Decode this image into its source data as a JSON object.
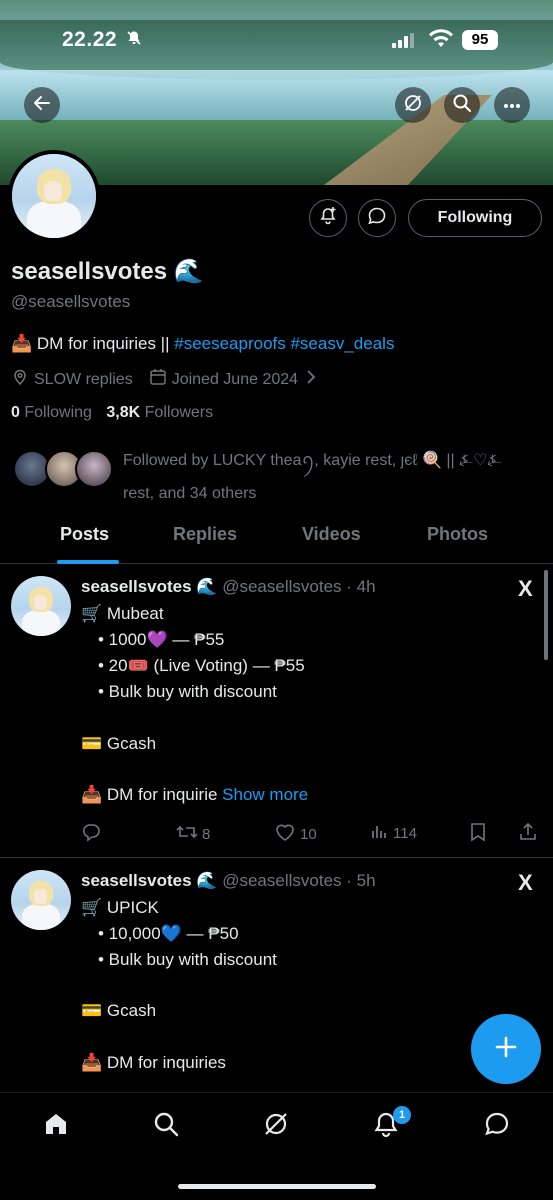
{
  "status_bar": {
    "time": "22.22",
    "battery": "95"
  },
  "profile": {
    "display_name": "seasellsvotes",
    "name_emoji": "🌊",
    "handle": "@seasellsvotes",
    "bio_emoji": "📥",
    "bio_text": "DM for inquiries ||",
    "bio_hashtags": "#seeseaproofs #seasv_deals",
    "location": "SLOW replies",
    "joined": "Joined June 2024",
    "following_count": "0",
    "following_label": "Following",
    "followers_count": "3,8K",
    "followers_label": "Followers",
    "followed_by": "Followed by LUCKY theaꪆ, kayie rest, ȷєℓ 🍭 || ⍼♡⍼ rest, and 34 others",
    "following_button": "Following"
  },
  "tabs": [
    "Posts",
    "Replies",
    "Videos",
    "Photos"
  ],
  "tweets": [
    {
      "name": "seasellsvotes 🌊",
      "meta": "@seasellsvotes · 4h",
      "lines": [
        "🛒 Mubeat",
        "• 1000💜  — ₱55",
        "• 20🎟️  (Live Voting) — ₱55",
        "• Bulk buy with discount",
        "💳 Gcash",
        "📥 DM for inquirie"
      ],
      "show_more": "Show more",
      "replies": "",
      "reposts": "8",
      "likes": "10",
      "views": "114"
    },
    {
      "name": "seasellsvotes 🌊",
      "meta": "@seasellsvotes · 5h",
      "lines": [
        "🛒 UPICK",
        "• 10,000💙  — ₱50",
        "• Bulk buy with discount",
        "💳 Gcash",
        "📥 DM for inquiries"
      ]
    }
  ],
  "notifications_badge": "1",
  "x_logo": "X",
  "colors": {
    "accent": "#1d9bf0",
    "background": "#000000",
    "muted": "#71767b"
  },
  "icons": [
    "back-arrow-icon",
    "grok-icon",
    "search-icon",
    "more-icon",
    "notify-plus-icon",
    "message-icon",
    "location-icon",
    "calendar-icon",
    "chevron-right-icon",
    "reply-icon",
    "repost-icon",
    "like-icon",
    "views-icon",
    "bookmark-icon",
    "share-icon",
    "compose-plus-icon",
    "home-icon",
    "notifications-icon"
  ]
}
